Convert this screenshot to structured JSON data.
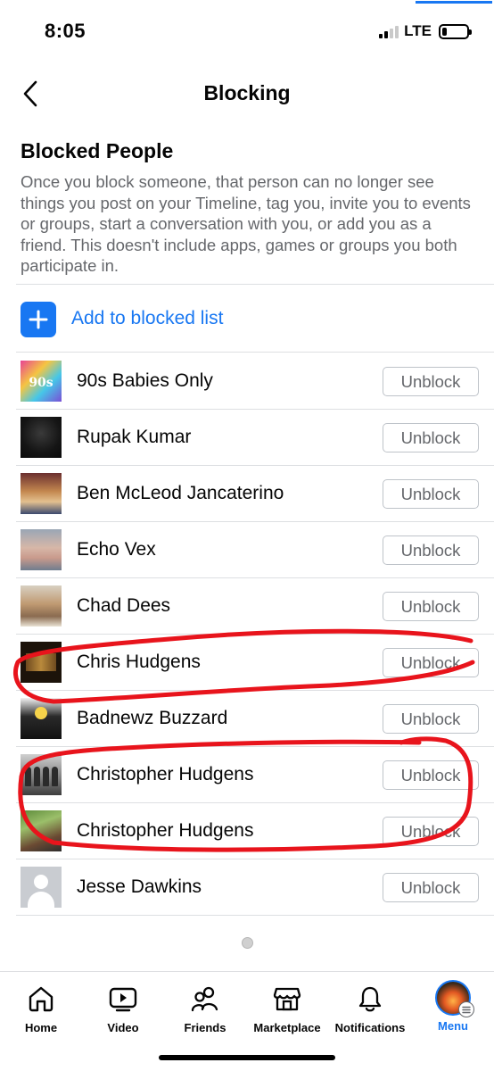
{
  "status_bar": {
    "time": "8:05",
    "network": "LTE",
    "battery_level": 0.2,
    "signal_bars": 2
  },
  "header": {
    "back_icon": "chevron-left-icon",
    "title": "Blocking"
  },
  "section": {
    "title": "Blocked People",
    "description": "Once you block someone, that person can no longer see things you post on your Timeline, tag you, invite you to events or groups, start a conversation with you, or add you as a friend. This doesn't include apps, games or groups you both participate in."
  },
  "add_action": {
    "icon": "plus-icon",
    "label": "Add to blocked list"
  },
  "blocked_people": [
    {
      "name": "90s Babies Only",
      "action": "Unblock",
      "avatar": "group-photo-90s"
    },
    {
      "name": "Rupak Kumar",
      "action": "Unblock",
      "avatar": "profile-photo-dark"
    },
    {
      "name": "Ben McLeod Jancaterino",
      "action": "Unblock",
      "avatar": "profile-photo"
    },
    {
      "name": "Echo Vex",
      "action": "Unblock",
      "avatar": "profile-photo"
    },
    {
      "name": "Chad Dees",
      "action": "Unblock",
      "avatar": "profile-photo-cartoon"
    },
    {
      "name": "Chris Hudgens",
      "action": "Unblock",
      "avatar": "profile-photo-dark"
    },
    {
      "name": "Badnewz Buzzard",
      "action": "Unblock",
      "avatar": "profile-photo"
    },
    {
      "name": "Christopher Hudgens",
      "action": "Unblock",
      "avatar": "profile-photo"
    },
    {
      "name": "Christopher Hudgens",
      "action": "Unblock",
      "avatar": "profile-photo"
    },
    {
      "name": "Jesse Dawkins",
      "action": "Unblock",
      "avatar": "default-avatar"
    }
  ],
  "tab_bar": {
    "tabs": [
      {
        "label": "Home",
        "icon": "home-icon",
        "active": false
      },
      {
        "label": "Video",
        "icon": "video-icon",
        "active": false
      },
      {
        "label": "Friends",
        "icon": "friends-icon",
        "active": false
      },
      {
        "label": "Marketplace",
        "icon": "marketplace-icon",
        "active": false
      },
      {
        "label": "Notifications",
        "icon": "bell-icon",
        "active": false
      },
      {
        "label": "Menu",
        "icon": "menu-avatar",
        "active": true
      }
    ]
  },
  "colors": {
    "accent": "#1877f2",
    "text_primary": "#050505",
    "text_secondary": "#65676b",
    "border": "#dddfe2",
    "annotation": "#e8141c"
  }
}
